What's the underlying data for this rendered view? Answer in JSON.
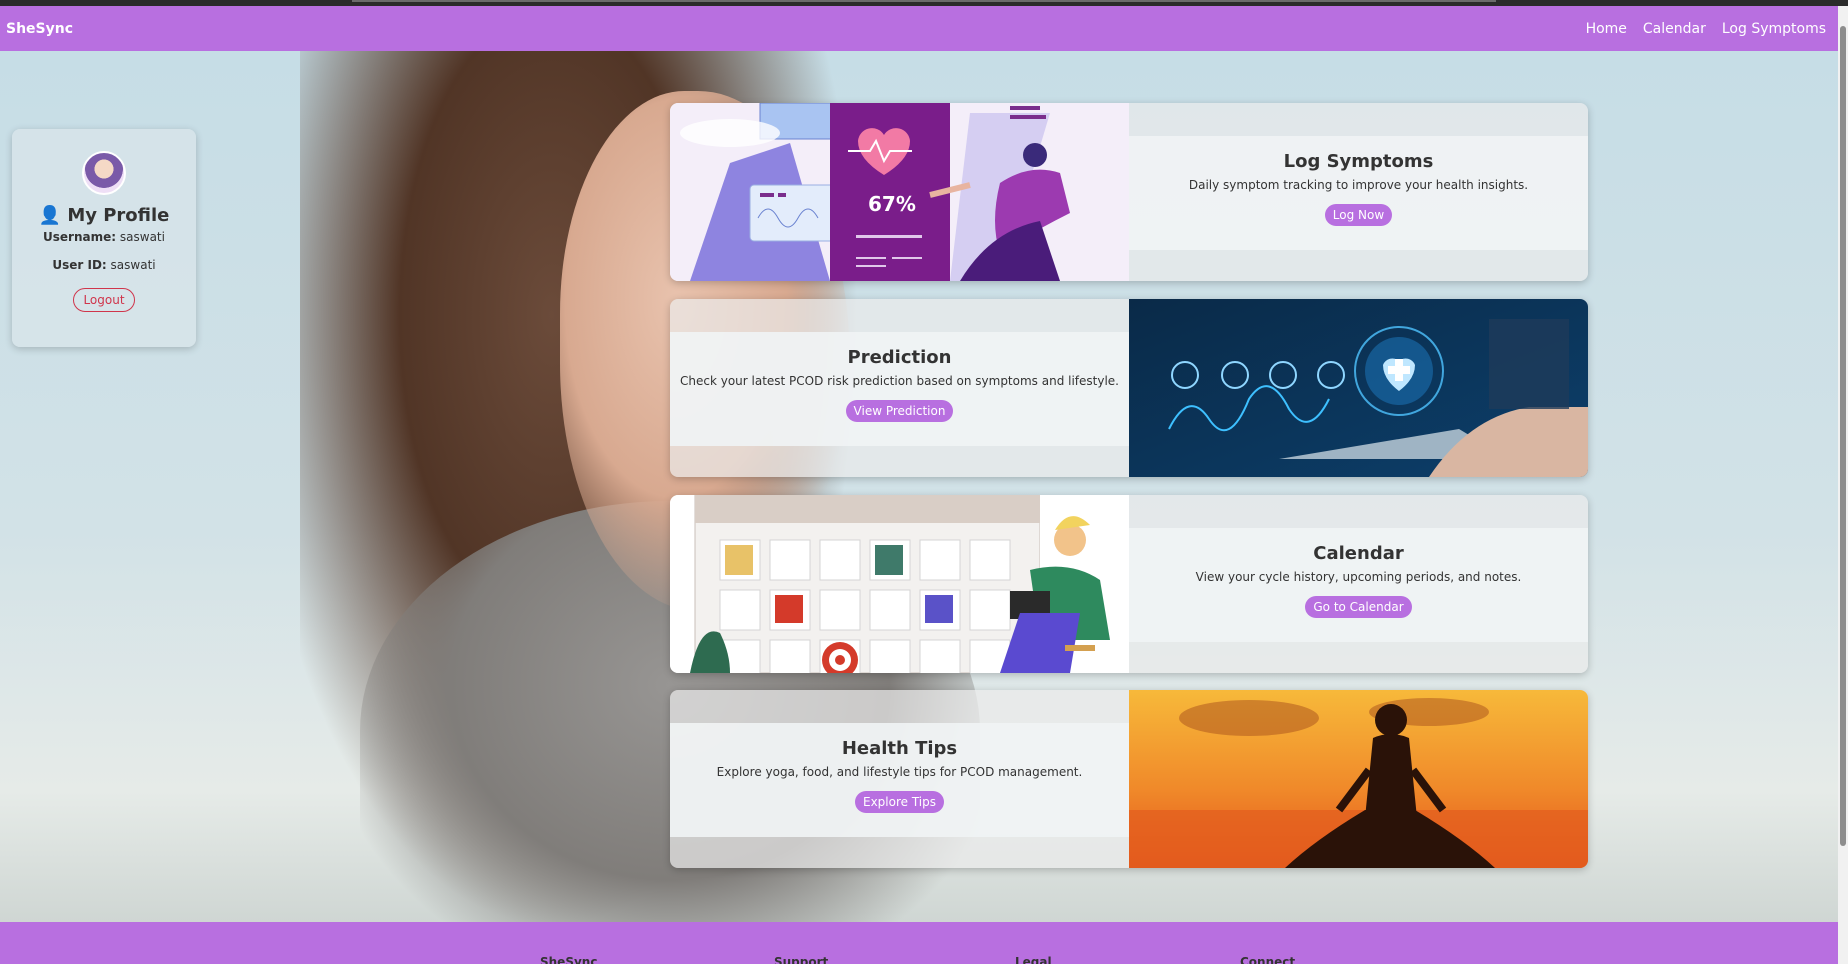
{
  "navbar": {
    "brand": "SheSync",
    "links": [
      "Home",
      "Calendar",
      "Log Symptoms"
    ]
  },
  "profile": {
    "icon": "user-icon",
    "title": "My Profile",
    "username_label": "Username:",
    "username": "saswati",
    "userid_label": "User ID:",
    "userid": "saswati",
    "logout_label": "Logout"
  },
  "cards": [
    {
      "title": "Log Symptoms",
      "description": "Daily symptom tracking to improve your health insights.",
      "button": "Log Now",
      "illustration_stat": "67%"
    },
    {
      "title": "Prediction",
      "description": "Check your latest PCOD risk prediction based on symptoms and lifestyle.",
      "button": "View Prediction"
    },
    {
      "title": "Calendar",
      "description": "View your cycle history, upcoming periods, and notes.",
      "button": "Go to Calendar"
    },
    {
      "title": "Health Tips",
      "description": "Explore yoga, food, and lifestyle tips for PCOD management.",
      "button": "Explore Tips"
    }
  ],
  "footer": {
    "columns": [
      "SheSync",
      "Support",
      "Legal",
      "Connect"
    ]
  },
  "colors": {
    "accent": "#b86fe0",
    "logout": "#d0354b"
  }
}
